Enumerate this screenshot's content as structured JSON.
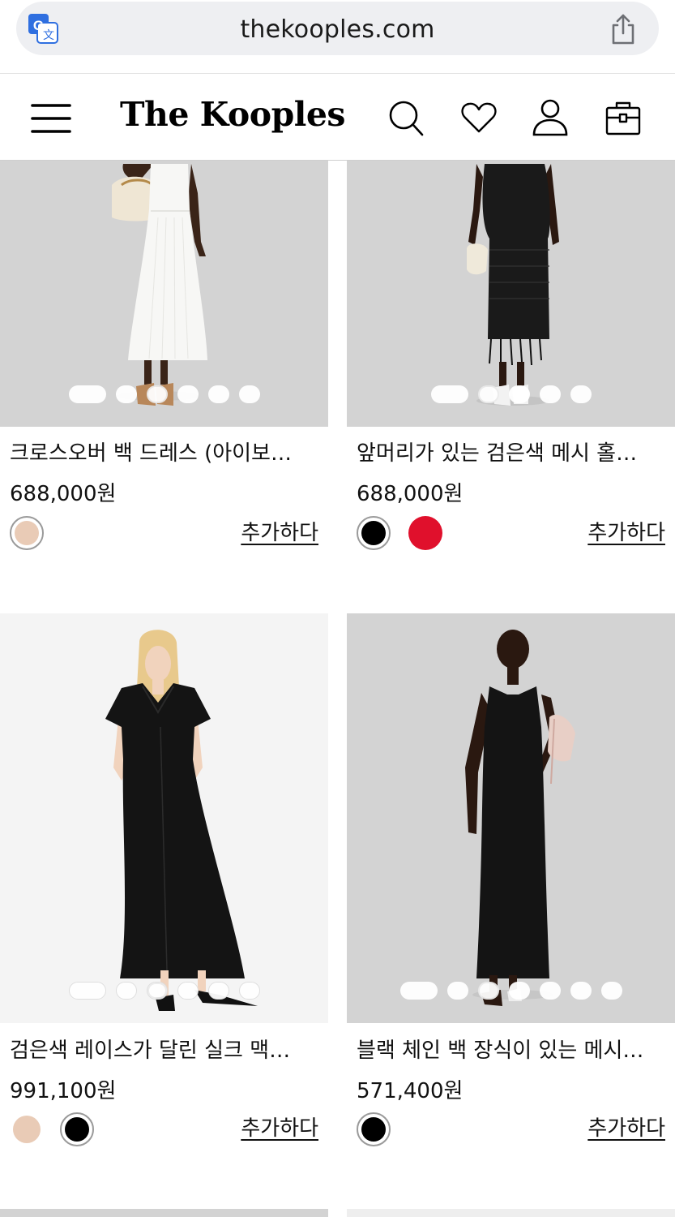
{
  "browser": {
    "url": "thekooples.com",
    "translate_icon": "translate-icon",
    "share_icon": "share-icon"
  },
  "header": {
    "logo": "The Kooples",
    "icons": [
      "menu-icon",
      "search-icon",
      "heart-icon",
      "account-icon",
      "bag-icon"
    ]
  },
  "products": [
    {
      "name": "크로스오버 백 드레스 (아이보…",
      "price": "688,000원",
      "add_label": "추가하다",
      "swatches": [
        "#e9cbb6"
      ],
      "selected_swatch": 0,
      "image_bg": "grey"
    },
    {
      "name": "앞머리가 있는 검은색 메시 홀…",
      "price": "688,000원",
      "add_label": "추가하다",
      "swatches": [
        "#000000",
        "#e0102c"
      ],
      "selected_swatch": 0,
      "image_bg": "grey"
    },
    {
      "name": "검은색 레이스가 달린 실크 맥…",
      "price": "991,100원",
      "add_label": "추가하다",
      "swatches": [
        "#e9cbb6",
        "#000000"
      ],
      "selected_swatch": 1,
      "image_bg": "white"
    },
    {
      "name": "블랙 체인 백 장식이 있는 메시…",
      "price": "571,400원",
      "add_label": "추가하다",
      "swatches": [
        "#000000"
      ],
      "selected_swatch": 0,
      "image_bg": "grey"
    }
  ]
}
